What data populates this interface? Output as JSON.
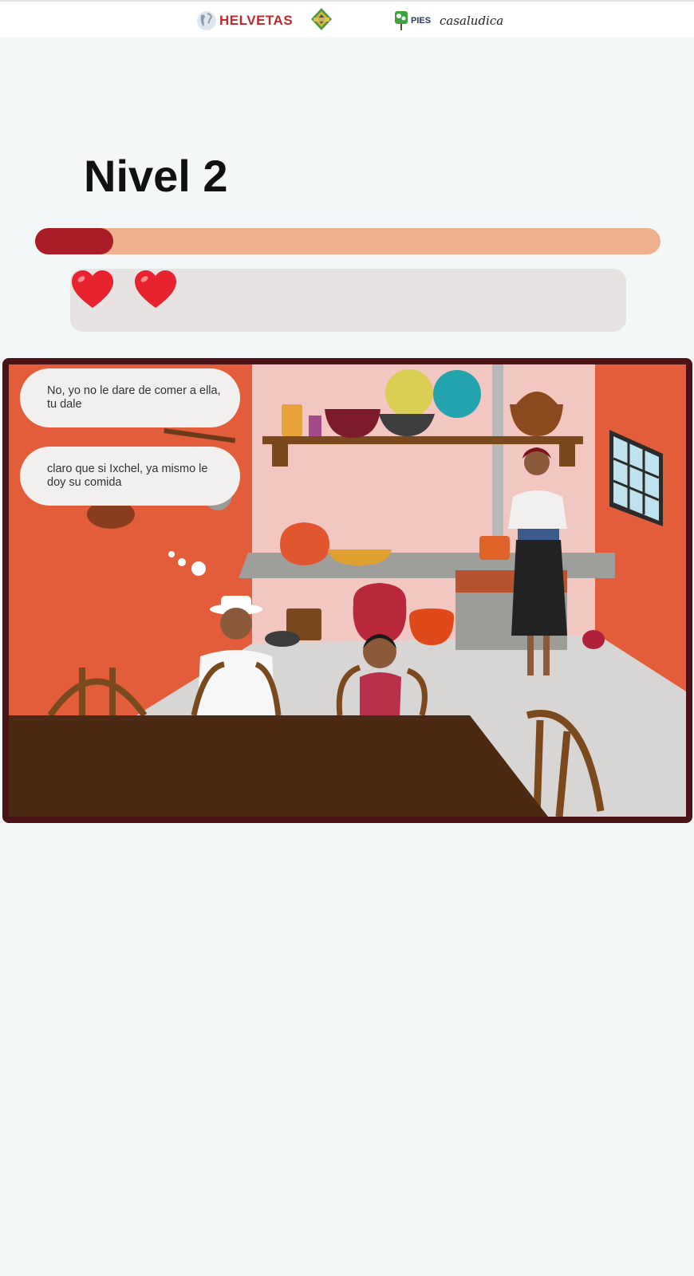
{
  "header": {
    "logos": [
      {
        "name": "helvetas",
        "text": "HELVETAS"
      },
      {
        "name": "kemenk",
        "text": ""
      },
      {
        "name": "pies",
        "text": "PIES"
      },
      {
        "name": "casa-ludica",
        "text": "casaludica"
      }
    ]
  },
  "level": {
    "title": "Nivel 2",
    "progress_fraction": 0.125
  },
  "lives": {
    "count": 2,
    "icon": "heart-icon",
    "color": "#e8222e"
  },
  "dialogue": [
    {
      "speaker": "man",
      "text": "No, yo no le dare de comer a ella, tu dale"
    },
    {
      "speaker": "woman",
      "text": "claro que si Ixchel, ya mismo le doy su comida"
    }
  ],
  "colors": {
    "progress_fill": "#aa1d27",
    "progress_track": "#eeb08d",
    "scene_border": "#4a1416",
    "background": "#f3f7f8"
  }
}
